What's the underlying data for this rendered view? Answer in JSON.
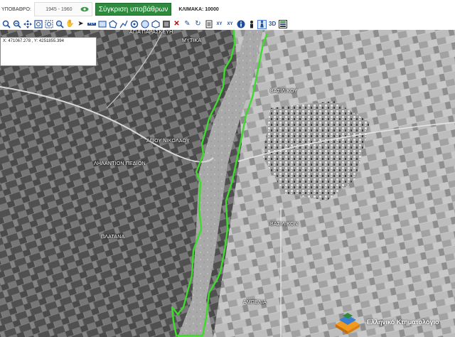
{
  "topbar": {
    "basemap_label": "ΥΠΟΒΑΘΡΟ:",
    "period_value": "1945 - 1960",
    "compare_button": "Σύγκριση υποβάθρων",
    "scale_label": "ΚΛΙΜΑΚΑ: 10000"
  },
  "toolbar": {
    "tools": [
      {
        "icon": "zoom-in-icon"
      },
      {
        "icon": "zoom-out-icon"
      },
      {
        "icon": "pan-icon"
      },
      {
        "icon": "zoom-extent-icon"
      },
      {
        "icon": "zoom-box-icon"
      },
      {
        "icon": "zoom-layer-icon"
      },
      {
        "icon": "hand-icon"
      },
      {
        "icon": "select-icon"
      },
      {
        "icon": "measure-line-icon"
      },
      {
        "icon": "measure-area-icon"
      },
      {
        "icon": "draw-polygon-icon"
      },
      {
        "icon": "draw-line-icon"
      },
      {
        "icon": "draw-point-icon"
      },
      {
        "icon": "draw-circle-icon"
      },
      {
        "icon": "draw-shape-icon"
      },
      {
        "icon": "layers-icon"
      },
      {
        "icon": "clear-icon"
      },
      {
        "icon": "edit-icon"
      },
      {
        "icon": "refresh-icon"
      },
      {
        "icon": "document-icon"
      },
      {
        "icon": "xy-icon"
      },
      {
        "icon": "xy-goto-icon"
      },
      {
        "icon": "info-icon"
      },
      {
        "icon": "person-icon"
      },
      {
        "icon": "street-view-icon"
      }
    ],
    "label_3d": "3D",
    "legend_icon": "legend-icon"
  },
  "coordinates": {
    "text": "X: 471067.278 , Y: 4251855.394"
  },
  "map": {
    "places": [
      {
        "key": "agia_paraskevi",
        "label": "ΑΓΙΑ ΠΑΡΑΣΚΕΥΗ"
      },
      {
        "key": "mytika",
        "label": "ΜΥΤΙΚΑ"
      },
      {
        "key": "vasiliko_north",
        "label": "ΒΑΣΙΛΙΚΟΥ"
      },
      {
        "key": "agiou_nikolaou",
        "label": "ΑΓΙΟΥ ΝΙΚΟΛΑΟΥ"
      },
      {
        "key": "lilantion",
        "label": "ΛΗΛΑΝΤΙΟΝ ΠΕΔΙΟΝ"
      },
      {
        "key": "vasilikon",
        "label": "ΒΑΣΙΛΙΚΟΝ"
      },
      {
        "key": "platana",
        "label": "ΠΛΑΤΑΝΑ"
      },
      {
        "key": "ampelia",
        "label": "ΑΜΠΕΛΙΑ"
      }
    ],
    "boundary_color": "#3ddc2a"
  },
  "logo": {
    "text": "Ελληνικό Κτηματολόγιο"
  }
}
